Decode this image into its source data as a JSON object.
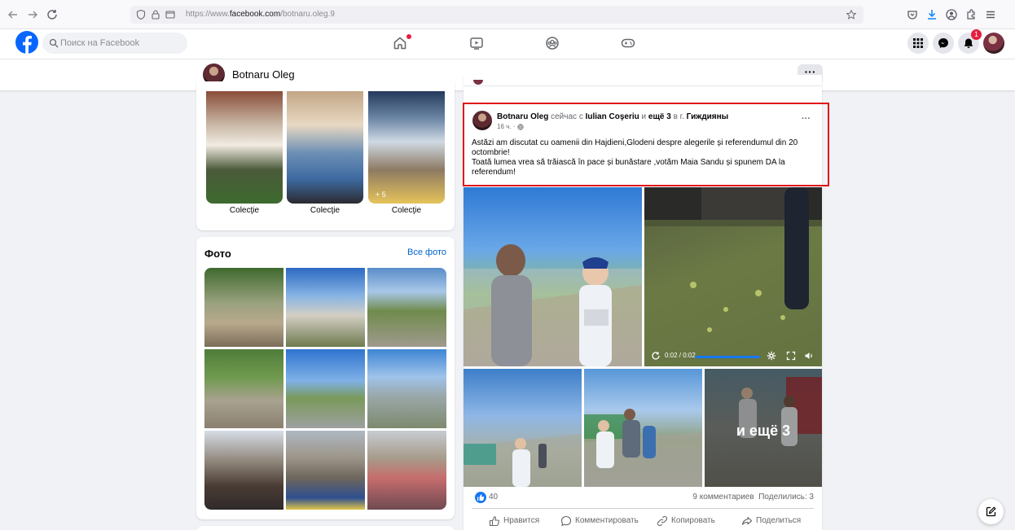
{
  "browser": {
    "url_prefix": "https://www.",
    "url_domain": "facebook.com",
    "url_path": "/botnaru.oleg.9"
  },
  "header": {
    "search_placeholder": "Поиск на Facebook",
    "notifications_count": "1",
    "nav_tabs": [
      "home-icon",
      "video-icon",
      "groups-icon",
      "gaming-icon"
    ]
  },
  "profile": {
    "name": "Botnaru Oleg",
    "more_label": "···"
  },
  "collections": {
    "items": [
      {
        "label": "Colecţie"
      },
      {
        "label": "Colecţie"
      },
      {
        "label": "Colecţie"
      }
    ],
    "more_count": "+ 5"
  },
  "photos": {
    "title": "Фото",
    "all_link": "Все фото"
  },
  "post": {
    "author": "Botnaru Oleg",
    "meta_now": "сейчас с",
    "tagged_person": "Iulian Coşeriu",
    "meta_and": "и",
    "tagged_more": "ещё 3",
    "meta_in": "в г.",
    "location": "Гиждияны",
    "time": "16 ч. ·",
    "more_label": "···",
    "text_line1": "Astăzi am discutat cu oamenii din Hajdieni,Glodeni despre alegerile și referendumul din 20 octombrie!",
    "text_line2": "Toată lumea vrea să trăiască în pace și bunăstare ,votăm Maia Sandu și spunem DA la referendum!",
    "more_photos_label": "и ещё 3",
    "video_time": "0:02 / 0:02",
    "video_progress": 1.0,
    "likes": "40",
    "comments": "9 комментариев",
    "shares": "Поделились: 3",
    "actions": {
      "like": "Нравится",
      "comment": "Комментировать",
      "copy": "Копировать",
      "share": "Поделиться"
    }
  },
  "colors": {
    "facebook_blue": "#0866ff",
    "highlight_red": "#e2141a",
    "notification_red": "#e41e3f",
    "link_blue": "#0064d1"
  }
}
